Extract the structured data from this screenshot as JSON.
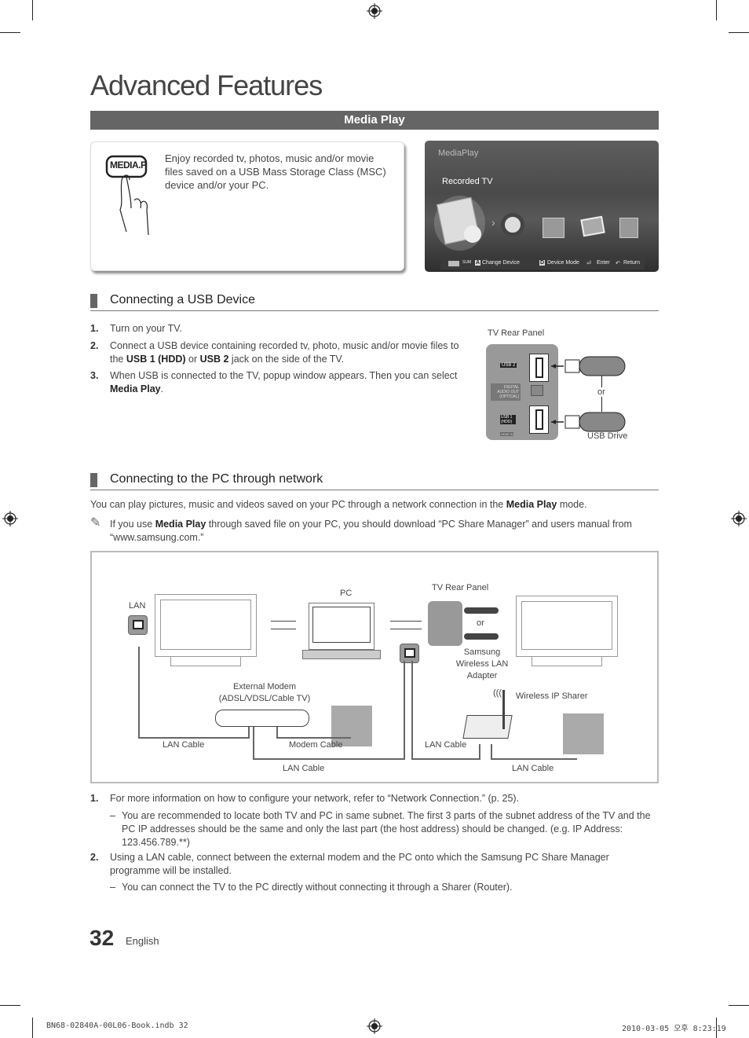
{
  "page": {
    "title": "Advanced Features",
    "section_bar": "Media Play",
    "page_number": "32",
    "language": "English"
  },
  "intro": {
    "button_label": "MEDIA.P",
    "text": "Enjoy recorded tv, photos, music and/or movie files saved on a USB Mass Storage Class (MSC) device and/or your PC."
  },
  "media_screen": {
    "app_title": "MediaPlay",
    "selected_item": "Recorded TV",
    "menu_icons": [
      "recorded-tv-icon",
      "videos-icon",
      "music-icon",
      "photos-icon",
      "setup-icon"
    ],
    "footer": {
      "sum_label": "SUM",
      "change_device_key": "A",
      "change_device": "Change Device",
      "device_mode_key": "D",
      "device_mode": "Device Mode",
      "enter": "Enter",
      "return": "Return"
    }
  },
  "usb_section": {
    "heading": "Connecting a USB Device",
    "steps": [
      {
        "num": "1.",
        "pre": "Turn on your TV."
      },
      {
        "num": "2.",
        "pre": "Connect a USB device containing recorded tv, photo, music and/or movie files to the ",
        "b1": "USB 1 (HDD)",
        "mid": " or ",
        "b2": "USB 2",
        "post": " jack on the side of the TV."
      },
      {
        "num": "3.",
        "pre": "When USB is connected to the TV, popup window appears. Then you can select ",
        "b1": "Media Play",
        "post": "."
      }
    ],
    "figure": {
      "panel_label": "TV Rear Panel",
      "port_usb2": "USB 2",
      "port_optical": "DIGITAL AUDIO OUT (OPTICAL)",
      "port_usb1": "USB 1 (HDD)",
      "port_hdmi": "HDMI IN",
      "or_label": "or",
      "drive_label": "USB Drive"
    }
  },
  "network_section": {
    "heading": "Connecting to the PC through network",
    "intro_pre": "You can play pictures, music and videos saved on your PC through a network connection in the ",
    "intro_b": "Media Play",
    "intro_post": " mode.",
    "note_pre": "If you use ",
    "note_b": "Media Play",
    "note_post": " through saved file on your PC, you should download “PC Share Manager” and users manual from “www.samsung.com.”",
    "diagram": {
      "lan": "LAN",
      "pc": "PC",
      "tv_rear_panel": "TV Rear Panel",
      "or": "or",
      "wireless_adapter": "Samsung Wireless LAN Adapter",
      "external_modem": "External Modem (ADSL/VDSL/Cable TV)",
      "wireless_sharer": "Wireless IP Sharer",
      "lan_cable_1": "LAN Cable",
      "modem_cable": "Modem Cable",
      "lan_cable_2": "LAN Cable",
      "lan_cable_3": "LAN Cable",
      "lan_cable_4": "LAN Cable"
    },
    "steps": [
      {
        "num": "1.",
        "text": "For more information on how to configure your network, refer to “Network Connection.” (p. 25).",
        "sub": "You are recommended to locate both TV and PC in same subnet. The first 3 parts of the subnet address of the TV and the PC IP addresses should be the same and only the last part (the host address) should be changed. (e.g. IP Address: 123.456.789.**)"
      },
      {
        "num": "2.",
        "text": "Using a LAN cable, connect between the external modem and the PC onto which the Samsung PC Share Manager programme will be installed.",
        "sub": "You can connect the TV to the PC directly without connecting it through a Sharer (Router)."
      }
    ]
  },
  "print_footer": {
    "file": "BN68-02840A-00L06-Book.indb   32",
    "timestamp": "2010-03-05   오후 8:23:19"
  }
}
